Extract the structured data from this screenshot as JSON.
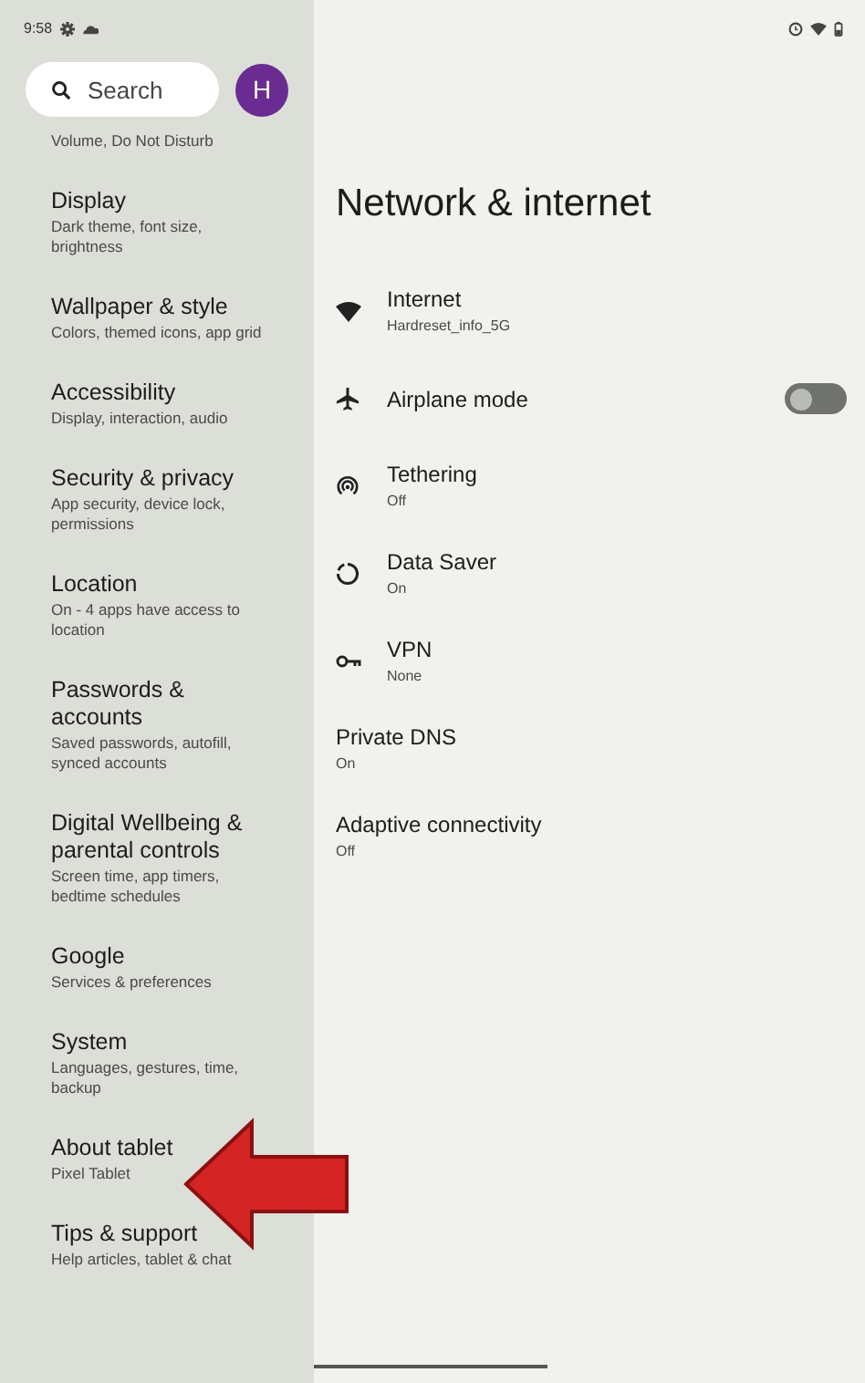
{
  "status_bar": {
    "time": "9:58"
  },
  "search": {
    "placeholder": "Search"
  },
  "avatar": {
    "letter": "H"
  },
  "sidebar": {
    "items": [
      {
        "subtitle": "Volume, Do Not Disturb"
      },
      {
        "title": "Display",
        "subtitle": "Dark theme, font size, brightness"
      },
      {
        "title": "Wallpaper & style",
        "subtitle": "Colors, themed icons, app grid"
      },
      {
        "title": "Accessibility",
        "subtitle": "Display, interaction, audio"
      },
      {
        "title": "Security & privacy",
        "subtitle": "App security, device lock, permissions"
      },
      {
        "title": "Location",
        "subtitle": "On - 4 apps have access to location"
      },
      {
        "title": "Passwords & accounts",
        "subtitle": "Saved passwords, autofill, synced accounts"
      },
      {
        "title": "Digital Wellbeing & parental controls",
        "subtitle": "Screen time, app timers, bedtime schedules"
      },
      {
        "title": "Google",
        "subtitle": "Services & preferences"
      },
      {
        "title": "System",
        "subtitle": "Languages, gestures, time, backup"
      },
      {
        "title": "About tablet",
        "subtitle": "Pixel Tablet"
      },
      {
        "title": "Tips & support",
        "subtitle": "Help articles, tablet & chat"
      }
    ]
  },
  "page": {
    "title": "Network & internet",
    "items": [
      {
        "kind": "wifi",
        "title": "Internet",
        "subtitle": "Hardreset_info_5G"
      },
      {
        "kind": "airplane",
        "title": "Airplane mode",
        "on": false
      },
      {
        "kind": "hotspot",
        "title": "Tethering",
        "subtitle": "Off"
      },
      {
        "kind": "datasaver",
        "title": "Data Saver",
        "subtitle": "On"
      },
      {
        "kind": "vpn",
        "title": "VPN",
        "subtitle": "None"
      },
      {
        "kind": "plain",
        "title": "Private DNS",
        "subtitle": "On"
      },
      {
        "kind": "plain",
        "title": "Adaptive connectivity",
        "subtitle": "Off"
      }
    ]
  }
}
